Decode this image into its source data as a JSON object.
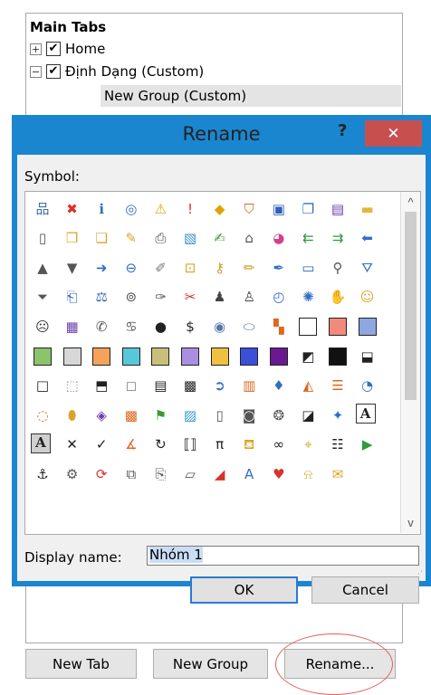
{
  "tree": {
    "title": "Main Tabs",
    "home": {
      "expander": "+",
      "check": "✔",
      "label": "Home"
    },
    "custom": {
      "expander": "−",
      "check": "✔",
      "label": "Định Dạng (Custom)"
    },
    "group": {
      "label": "New Group (Custom)"
    }
  },
  "bottom_buttons": {
    "new_tab": "New Tab",
    "new_group": "New Group",
    "rename": "Rename..."
  },
  "dialog": {
    "title": "Rename",
    "help": "?",
    "close": "✕",
    "symbol_label": "Symbol:",
    "display_name_label": "Display name:",
    "display_name_value": "Nhóm 1",
    "ok": "OK",
    "cancel": "Cancel",
    "scroll_up": "^",
    "scroll_down": "v"
  },
  "colors": {
    "dialog_frame": "#1a86d0",
    "close_button": "#c7504f",
    "ok_border": "#2a7ad4",
    "rename_highlight": "#e35b5b"
  },
  "symbols": [
    {
      "name": "org-chart-icon",
      "g": "品",
      "c": "#3d6fa8"
    },
    {
      "name": "error-icon",
      "g": "✖",
      "c": "#d8322a"
    },
    {
      "name": "info-icon",
      "g": "ℹ",
      "c": "#2f6fc7"
    },
    {
      "name": "ring-icon",
      "g": "◎",
      "c": "#2f6fc7"
    },
    {
      "name": "warning-icon",
      "g": "⚠",
      "c": "#e1a200"
    },
    {
      "name": "exclamation-icon",
      "g": "!",
      "c": "#d8322a"
    },
    {
      "name": "diamond-warning-icon",
      "g": "◆",
      "c": "#e1a200"
    },
    {
      "name": "shield-icon",
      "g": "⛉",
      "c": "#e0661e"
    },
    {
      "name": "save-icon",
      "g": "▣",
      "c": "#2f5fb8"
    },
    {
      "name": "copy-icon",
      "g": "❐",
      "c": "#2f6fc7"
    },
    {
      "name": "save-all-icon",
      "g": "▤",
      "c": "#6a3fb0"
    },
    {
      "name": "folder-icon",
      "g": "▬",
      "c": "#e6b53a"
    },
    {
      "name": "new-document-icon",
      "g": "▯",
      "c": "#555555"
    },
    {
      "name": "open-folder-icon",
      "g": "❒",
      "c": "#d9a425"
    },
    {
      "name": "folders-icon",
      "g": "❏",
      "c": "#d9a425"
    },
    {
      "name": "edit-folder-icon",
      "g": "✎",
      "c": "#d9a425"
    },
    {
      "name": "print-icon",
      "g": "⎙",
      "c": "#444444"
    },
    {
      "name": "picture-icon",
      "g": "▧",
      "c": "#3a8fd0"
    },
    {
      "name": "sign-icon",
      "g": "✍",
      "c": "#3a9a3a"
    },
    {
      "name": "home-icon",
      "g": "⌂",
      "c": "#555555"
    },
    {
      "name": "palette-icon",
      "g": "◕",
      "c": "#d43f8d"
    },
    {
      "name": "back-arrows-icon",
      "g": "⇇",
      "c": "#2f9a3f"
    },
    {
      "name": "forward-arrows-icon",
      "g": "⇉",
      "c": "#2f9a3f"
    },
    {
      "name": "left-arrow-icon",
      "g": "⬅",
      "c": "#2f6fc7"
    },
    {
      "name": "triangle-up-icon",
      "g": "▲",
      "c": "#555555"
    },
    {
      "name": "triangle-down-icon",
      "g": "▼",
      "c": "#555555"
    },
    {
      "name": "right-arrow-icon",
      "g": "➜",
      "c": "#2f6fc7"
    },
    {
      "name": "back-circle-icon",
      "g": "⊖",
      "c": "#2f6fc7"
    },
    {
      "name": "pushpin-icon",
      "g": "✐",
      "c": "#777777"
    },
    {
      "name": "lock-icon",
      "g": "⊡",
      "c": "#d9a425"
    },
    {
      "name": "key-icon",
      "g": "⚷",
      "c": "#c8a020"
    },
    {
      "name": "pencil-icon",
      "g": "✏",
      "c": "#c8a020"
    },
    {
      "name": "highlighter-icon",
      "g": "✒",
      "c": "#2f6fc7"
    },
    {
      "name": "window-icon",
      "g": "▭",
      "c": "#2f5fb8"
    },
    {
      "name": "magnifier-icon",
      "g": "⚲",
      "c": "#555555"
    },
    {
      "name": "filter-icon",
      "g": "⛛",
      "c": "#2f6fc7"
    },
    {
      "name": "filter-dark-icon",
      "g": "⏷",
      "c": "#555555"
    },
    {
      "name": "book-icon",
      "g": "⎗",
      "c": "#2f5fb8"
    },
    {
      "name": "scales-icon",
      "g": "⚖",
      "c": "#2f5fb8"
    },
    {
      "name": "glasses-icon",
      "g": "⊚",
      "c": "#555555"
    },
    {
      "name": "wrench-icon",
      "g": "✑",
      "c": "#555555"
    },
    {
      "name": "tools-icon",
      "g": "✂",
      "c": "#d8322a"
    },
    {
      "name": "person-icon",
      "g": "♟",
      "c": "#444444"
    },
    {
      "name": "user-icon",
      "g": "♙",
      "c": "#444444"
    },
    {
      "name": "clock-icon",
      "g": "◴",
      "c": "#2f6fc7"
    },
    {
      "name": "sparkle-icon",
      "g": "✺",
      "c": "#2f6fc7"
    },
    {
      "name": "hand-icon",
      "g": "✋",
      "c": "#d9a425"
    },
    {
      "name": "smiley-icon",
      "g": "☺",
      "c": "#d9a425"
    },
    {
      "name": "frown-icon",
      "g": "☹",
      "c": "#333333"
    },
    {
      "name": "calculator-icon",
      "g": "▦",
      "c": "#6a3fb0"
    },
    {
      "name": "phone-icon",
      "g": "✆",
      "c": "#555555"
    },
    {
      "name": "piggy-bank-icon",
      "g": "♋",
      "c": "#555555"
    },
    {
      "name": "ball-icon",
      "g": "●",
      "c": "#222222"
    },
    {
      "name": "dollar-icon",
      "g": "$",
      "c": "#222222"
    },
    {
      "name": "eye-icon",
      "g": "◉",
      "c": "#5577aa"
    },
    {
      "name": "disc-icon",
      "g": "⬭",
      "c": "#5577aa"
    },
    {
      "name": "color-squares-icon",
      "g": "▚",
      "c": "#e0661e"
    },
    {
      "name": "white-square-icon",
      "sq": "#ffffff"
    },
    {
      "name": "salmon-square-icon",
      "sq": "#f08a7c"
    },
    {
      "name": "lavender-square-icon",
      "sq": "#8fa6e0"
    },
    {
      "name": "green-square-icon",
      "sq": "#8cc46c"
    },
    {
      "name": "gray-square-icon",
      "sq": "#d7d7d7"
    },
    {
      "name": "orange-square-icon",
      "sq": "#f5a25a"
    },
    {
      "name": "cyan-square-icon",
      "sq": "#58c8d8"
    },
    {
      "name": "khaki-square-icon",
      "sq": "#c8bf7a"
    },
    {
      "name": "purple-square-icon",
      "sq": "#a98fe0"
    },
    {
      "name": "yellow-square-icon",
      "sq": "#f0c040"
    },
    {
      "name": "blue-square-icon",
      "sq": "#3a50d8"
    },
    {
      "name": "violet-square-icon",
      "sq": "#6a1a90"
    },
    {
      "name": "half-square-icon",
      "g": "◩",
      "c": "#222222"
    },
    {
      "name": "black-square-icon",
      "sq": "#111111"
    },
    {
      "name": "bottom-half-square-icon",
      "g": "⬓",
      "c": "#222222"
    },
    {
      "name": "outline-square-icon",
      "g": "□",
      "c": "#222222"
    },
    {
      "name": "dotted-square-icon",
      "g": "⬚",
      "c": "#999999"
    },
    {
      "name": "bottom-fill-square-icon",
      "g": "⬒",
      "c": "#222222"
    },
    {
      "name": "empty-square-icon",
      "g": "◻",
      "c": "#888888"
    },
    {
      "name": "stripe-square-icon",
      "g": "▤",
      "c": "#222222"
    },
    {
      "name": "checker-square-icon",
      "g": "▩",
      "c": "#222222"
    },
    {
      "name": "circle-arrow-icon",
      "g": "➲",
      "c": "#2f6fc7"
    },
    {
      "name": "bar-chart-icon",
      "g": "▥",
      "c": "#e0661e"
    },
    {
      "name": "drop-icon",
      "g": "♦",
      "c": "#2f6fc7"
    },
    {
      "name": "area-chart-icon",
      "g": "◭",
      "c": "#e0661e"
    },
    {
      "name": "stacked-bar-icon",
      "g": "☰",
      "c": "#e0661e"
    },
    {
      "name": "pie-chart-icon",
      "g": "◔",
      "c": "#2f6fc7"
    },
    {
      "name": "donut-chart-icon",
      "g": "◌",
      "c": "#e0661e"
    },
    {
      "name": "cylinder-icon",
      "g": "⬮",
      "c": "#d9a425"
    },
    {
      "name": "layers-icon",
      "g": "◈",
      "c": "#6a3fb0"
    },
    {
      "name": "boxes-icon",
      "g": "▩",
      "c": "#e0661e"
    },
    {
      "name": "hierarchy-icon",
      "g": "⚑",
      "c": "#3a9a3a"
    },
    {
      "name": "landscape-icon",
      "g": "▨",
      "c": "#2f9ad0"
    },
    {
      "name": "note-icon",
      "g": "▯",
      "c": "#555555"
    },
    {
      "name": "contact-card-icon",
      "g": "◙",
      "c": "#555555"
    },
    {
      "name": "globe-icon",
      "g": "❂",
      "c": "#555555"
    },
    {
      "name": "diagram-icon",
      "g": "◪",
      "c": "#222222"
    },
    {
      "name": "tree-people-icon",
      "g": "✦",
      "c": "#2f6fc7"
    },
    {
      "name": "text-box-icon",
      "g": "A",
      "c": "#222222",
      "box": true
    },
    {
      "name": "text-fill-icon",
      "g": "A",
      "c": "#222222",
      "box": true,
      "shade": true
    },
    {
      "name": "cross-icon",
      "g": "✕",
      "c": "#222222"
    },
    {
      "name": "check-icon",
      "g": "✓",
      "c": "#222222"
    },
    {
      "name": "angle-icon",
      "g": "∡",
      "c": "#e0661e"
    },
    {
      "name": "refresh-icon",
      "g": "↻",
      "c": "#222222"
    },
    {
      "name": "matrix-icon",
      "g": "⟦⟧",
      "c": "#222222"
    },
    {
      "name": "pi-icon",
      "g": "π",
      "c": "#222222"
    },
    {
      "name": "paint-bucket-icon",
      "g": "⛾",
      "c": "#d9a425"
    },
    {
      "name": "binoculars-icon",
      "g": "∞",
      "c": "#222222"
    },
    {
      "name": "broom-icon",
      "g": "⌖",
      "c": "#d9a425"
    },
    {
      "name": "list-icon",
      "g": "☷",
      "c": "#222222"
    },
    {
      "name": "play-icon",
      "g": "▶",
      "c": "#2f9a3f"
    },
    {
      "name": "anchor-icon",
      "g": "⚓",
      "c": "#222222"
    },
    {
      "name": "gear-person-icon",
      "g": "⚙",
      "c": "#555555"
    },
    {
      "name": "lasso-icon",
      "g": "⟳",
      "c": "#d8322a"
    },
    {
      "name": "shapes-icon",
      "g": "⧉",
      "c": "#555555"
    },
    {
      "name": "clipboard-icon",
      "g": "⎘",
      "c": "#555555"
    },
    {
      "name": "page-icon",
      "g": "▱",
      "c": "#555555"
    },
    {
      "name": "eraser-icon",
      "g": "◢",
      "c": "#d8322a"
    },
    {
      "name": "text-effects-icon",
      "g": "A",
      "c": "#2f6fc7"
    },
    {
      "name": "heart-icon",
      "g": "♥",
      "c": "#d8322a"
    },
    {
      "name": "bell-icon",
      "g": "⍾",
      "c": "#d9a425"
    },
    {
      "name": "envelope-icon",
      "g": "✉",
      "c": "#d9a425"
    }
  ]
}
